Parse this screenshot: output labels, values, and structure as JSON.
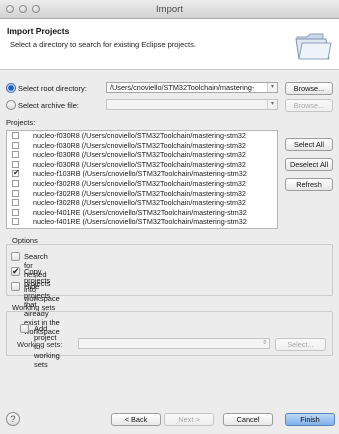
{
  "window": {
    "title": "Import"
  },
  "header": {
    "title": "Import Projects",
    "description": "Select a directory to search for existing Eclipse projects."
  },
  "root_dir": {
    "label": "Select root directory:",
    "value": "/Users/cnoviello/STM32Toolchain/mastering-",
    "browse": "Browse..."
  },
  "archive": {
    "label": "Select archive file:",
    "value": "",
    "browse": "Browse..."
  },
  "projects": {
    "label": "Projects:",
    "items": [
      {
        "text": "nucleo-f030R8 (/Users/cnoviello/STM32Toolchain/mastering-stm32",
        "checked": false
      },
      {
        "text": "nucleo-f030R8 (/Users/cnoviello/STM32Toolchain/mastering-stm32",
        "checked": false
      },
      {
        "text": "nucleo-f030R8 (/Users/cnoviello/STM32Toolchain/mastering-stm32",
        "checked": false
      },
      {
        "text": "nucleo-f030R8 (/Users/cnoviello/STM32Toolchain/mastering-stm32",
        "checked": false
      },
      {
        "text": "nucleo-f103RB (/Users/cnoviello/STM32Toolchain/mastering-stm32",
        "checked": true
      },
      {
        "text": "nucleo-f302R8 (/Users/cnoviello/STM32Toolchain/mastering-stm32",
        "checked": false
      },
      {
        "text": "nucleo-f302R8 (/Users/cnoviello/STM32Toolchain/mastering-stm32",
        "checked": false
      },
      {
        "text": "nucleo-f302R8 (/Users/cnoviello/STM32Toolchain/mastering-stm32",
        "checked": false
      },
      {
        "text": "nucleo-f401RE (/Users/cnoviello/STM32Toolchain/mastering-stm32",
        "checked": false
      },
      {
        "text": "nucleo-f401RE (/Users/cnoviello/STM32Toolchain/mastering-stm32",
        "checked": false
      }
    ],
    "select_all": "Select All",
    "deselect_all": "Deselect All",
    "refresh": "Refresh"
  },
  "options": {
    "title": "Options",
    "nested": "Search for nested projects",
    "copy": "Copy projects into workspace",
    "hide": "Hide projects that already exist in the workspace"
  },
  "working_sets": {
    "title": "Working sets",
    "add": "Add project to working sets",
    "label": "Working sets:",
    "select": "Select..."
  },
  "footer": {
    "help": "?",
    "back": "< Back",
    "next": "Next >",
    "cancel": "Cancel",
    "finish": "Finish"
  }
}
